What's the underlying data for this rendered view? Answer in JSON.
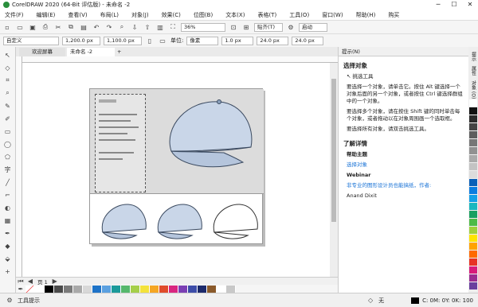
{
  "window": {
    "title": "CorelDRAW 2020 (64-Bit 评估版) - 未命名 -2",
    "minimize": "─",
    "maximize": "☐",
    "close": "✕"
  },
  "menu": [
    "文件(F)",
    "编辑(E)",
    "查看(V)",
    "布局(L)",
    "对象(J)",
    "效果(C)",
    "位图(B)",
    "文本(X)",
    "表格(T)",
    "工具(O)",
    "窗口(W)",
    "帮助(H)",
    "购买"
  ],
  "toolbar1": {
    "zoom": "36%",
    "snap": "贴齐(T)",
    "launch": "启动"
  },
  "toolbar2": {
    "preset": "自定义",
    "width": "1,200.0 px",
    "height": "1,100.0 px",
    "units_label": "单位:",
    "units": "像素",
    "nudge": "1 px",
    "dup_x": "24.0 px",
    "dup_y": "24.0 px",
    "xy_step": "1.0 px"
  },
  "tabs": {
    "home": "欢迎屏幕",
    "doc": "未命名 -2",
    "add": "+"
  },
  "page_nav": {
    "page": "页 1"
  },
  "panel": {
    "header": "提示(N)",
    "section1": "选择对象",
    "tool": "挑选工具",
    "bullets": [
      "要选择一个对象，请单击它。按住 Alt 键选择一个对象后面的另一个对象，或者按住 Ctrl 键选择群组中的一个对象。",
      "要选择多个对象，请在按住 Shift 键的同时单击每个对象，或者拖动以在对象周围画一个选取框。",
      "要选择所有对象，请双击挑选工具。"
    ],
    "section2": "了解详情",
    "help_title": "帮助主题",
    "help_link": "选择对象",
    "webinar_title": "Webinar",
    "webinar_text": "非专业的图形设计员也能搞纸，作者:",
    "webinar_author": "Anand Dixit"
  },
  "side_tabs": [
    "提示",
    "属性",
    "对象 (O)"
  ],
  "status": {
    "tool_hint": "工具提示",
    "fill": "无",
    "color": "C: 0M: 0Y: 0K: 100"
  },
  "colors": {
    "palette": [
      "#ffffff",
      "#000000",
      "#4a4a4a",
      "#7a7a7a",
      "#a9a9a9",
      "#d8d8d8",
      "#1e73c8",
      "#5aa0e0",
      "#1b9a9a",
      "#55b86c",
      "#a5cf4a",
      "#f3e23a",
      "#f5a623",
      "#e04b2b",
      "#d92680",
      "#7b3fb4",
      "#3d4da8",
      "#1c2a6b",
      "#8a5a2b",
      "#ffffff",
      "#c8c8c8"
    ],
    "right_colors": [
      "#ffffff",
      "#111111",
      "#2a2a2a",
      "#444444",
      "#5e5e5e",
      "#777777",
      "#919191",
      "#aaaaaa",
      "#c3c3c3",
      "#dcdcdc",
      "#0a60b8",
      "#0b7de0",
      "#13a0e8",
      "#1ab7bf",
      "#18a060",
      "#4dbb46",
      "#9fd03b",
      "#ffe400",
      "#ffa300",
      "#ff6a00",
      "#e73224",
      "#d81b7a",
      "#9b2c90",
      "#6a3f9e"
    ]
  }
}
